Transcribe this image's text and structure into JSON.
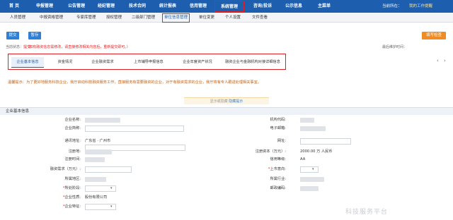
{
  "topnav": {
    "items": [
      "首 页",
      "申报管理",
      "公告管理",
      "经纪管理",
      "技术合同",
      "统计报表",
      "信用管理",
      "系统管理",
      "咨询/投诉",
      "公示信息",
      "主菜单"
    ],
    "right": "当前所在：",
    "right_link": "我的工作提醒",
    "active": "系统管理"
  },
  "subnav": {
    "items": [
      "人员管理",
      "中报资格管理",
      "专家库管理",
      "授权管理",
      "二级部门管理",
      "单位信息管理",
      "单位变更",
      "个人设置",
      "文件查看"
    ],
    "active": "单位信息管理"
  },
  "toolbar": {
    "submit": "提交",
    "save": "暂存",
    "fill_check": "填写检查"
  },
  "status": {
    "label": "当前状态：",
    "value": "提交",
    "hint": "（如有融资信息需修改，请直接修改相关内容后，重新提交即可。）"
  },
  "maintain_time": "最后维护时间：",
  "tabs": [
    "企业基本信息",
    "资金情况",
    "企业融资需求",
    "上市辅导申报信息",
    "企业年度资产状况",
    "融资企业与金融机构对接详细信息"
  ],
  "tab_nav": {
    "prev": "‹",
    "next": "›"
  },
  "notice": "温馨提示：为了更好地服务科技企业，我厅启动科技融资服务工作，直接服务有需要融资的企业，对于有融资需求的企业，我厅将有专人跟进处理相关事宜。",
  "hint_bar": {
    "text": "显示或隐藏",
    "link": "隐藏提示"
  },
  "section_title": "企业基本信息",
  "form": {
    "company_name": "企业名称:",
    "org_code": "机构代码:",
    "company_abbr": "企业简称:",
    "email": "电子邮箱:",
    "address": "通讯地址:",
    "address_value": "广东省 · 广州市",
    "website": "网址:",
    "reg_type": "注册地:",
    "reg_capital": "注册资本（万元）:",
    "reg_capital_value": "2000.00 万 人民币",
    "reg_time": "注册时间:",
    "credit_rating": "信用等级:",
    "credit_rating_value": "AA",
    "financing": "融资需求（万元）:",
    "listed": "上市意向:",
    "region": "所属地区:",
    "industry": "所属行业:",
    "stage": "所处阶段:",
    "postal": "邮政编码:",
    "nature": "企业性质:",
    "nature_value": "股份有限公司",
    "feature": "企业特征:"
  },
  "watermark": "科技服务平台"
}
